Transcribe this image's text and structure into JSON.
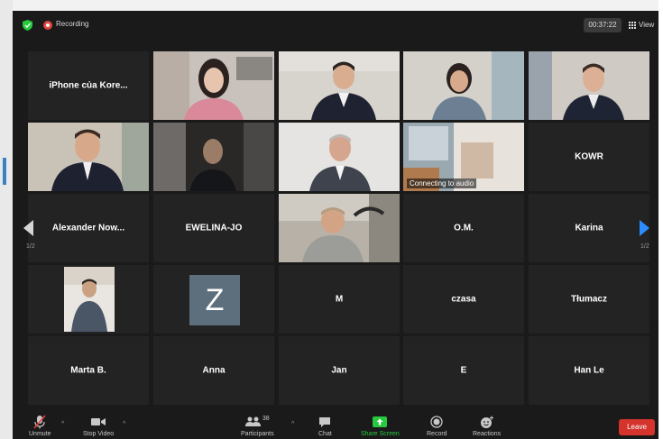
{
  "recording": {
    "label": "Recording"
  },
  "meeting": {
    "timer": "00:37:22",
    "view_label": "View"
  },
  "pagination": {
    "left": "1/2",
    "right": "1/2"
  },
  "participants": [
    {
      "name": "iPhone của Kore..."
    },
    {
      "name": "KOWR"
    },
    {
      "name": "Alexander Now..."
    },
    {
      "name": "EWELINA-JO"
    },
    {
      "name": "O.M."
    },
    {
      "name": "Karina"
    },
    {
      "name": "M"
    },
    {
      "name": "czasa"
    },
    {
      "name": "Tłumacz"
    },
    {
      "name": "Marta B."
    },
    {
      "name": "Anna"
    },
    {
      "name": "Jan"
    },
    {
      "name": "E"
    },
    {
      "name": "Han Le"
    }
  ],
  "avatar_letter": "Z",
  "connecting_label": "Connecting to audio",
  "toolbar": {
    "unmute": "Unmute",
    "stop_video": "Stop Video",
    "participants": "Participants",
    "participants_count": "38",
    "chat": "Chat",
    "share_screen": "Share Screen",
    "record": "Record",
    "reactions": "Reactions",
    "leave": "Leave"
  },
  "colors": {
    "background": "#1a1a1a",
    "tile": "#232323",
    "active_speaker": "#e6e64e",
    "leave": "#d4342c",
    "share": "#27c93f",
    "accent": "#2d8cff"
  }
}
